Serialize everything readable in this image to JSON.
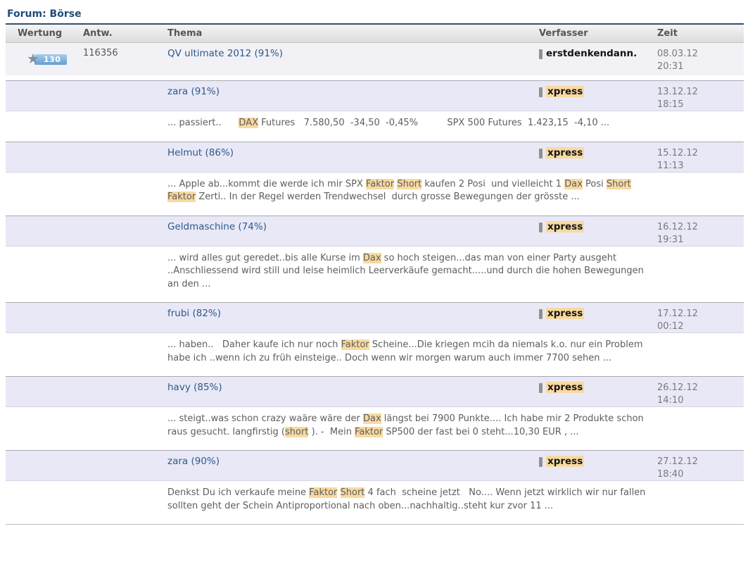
{
  "header": {
    "title": "Forum: Börse"
  },
  "colors": {
    "title_blue": "#1d4d7c",
    "link_blue": "#2b5a8c",
    "highlight_orange": "#f8d9a0",
    "topic_row_lavender": "#e9e8f6",
    "thread_row_gray": "#f2f1f6",
    "badge_blue": "#649ed2"
  },
  "icons": {
    "rating": "star-icon",
    "author_presence": "user-bar-icon"
  },
  "table": {
    "columns": [
      "Wertung",
      "Antw.",
      "Thema",
      "Verfasser",
      "Zeit"
    ],
    "rows": [
      {
        "type": "thread",
        "rating": "130",
        "answers": "116356",
        "topic": "QV ultimate 2012 (91%)",
        "author": {
          "name": "erstdenkendann.",
          "highlight": false
        },
        "date": "08.03.12",
        "time": "20:31",
        "snippet": null
      },
      {
        "type": "post",
        "rating": "",
        "answers": "",
        "topic": "zara (91%)",
        "author": {
          "name": "xpress",
          "highlight": true
        },
        "date": "13.12.12",
        "time": "18:15",
        "snippet": [
          {
            "t": "... passiert..      ",
            "h": false
          },
          {
            "t": "DAX",
            "h": true
          },
          {
            "t": " Futures   7.580,50  -34,50  -0,45%          SPX 500 Futures  1.423,15  -4,10 ...",
            "h": false
          }
        ]
      },
      {
        "type": "post",
        "rating": "",
        "answers": "",
        "topic": "Helmut (86%)",
        "author": {
          "name": "xpress",
          "highlight": true
        },
        "date": "15.12.12",
        "time": "11:13",
        "snippet": [
          {
            "t": "... Apple ab...kommt die werde ich mir SPX ",
            "h": false
          },
          {
            "t": "Faktor",
            "h": true
          },
          {
            "t": " ",
            "h": false
          },
          {
            "t": "Short",
            "h": true
          },
          {
            "t": " kaufen 2 Posi  und vielleicht 1 ",
            "h": false
          },
          {
            "t": "Dax",
            "h": true
          },
          {
            "t": " Posi ",
            "h": false
          },
          {
            "t": "Short",
            "h": true
          },
          {
            "t": " ",
            "h": false
          },
          {
            "t": "Faktor",
            "h": true
          },
          {
            "t": " Zerti.. In der Regel werden Trendwechsel  durch grosse Bewegungen der grösste ...",
            "h": false
          }
        ]
      },
      {
        "type": "post",
        "rating": "",
        "answers": "",
        "topic": "Geldmaschine (74%)",
        "author": {
          "name": "xpress",
          "highlight": true
        },
        "date": "16.12.12",
        "time": "19:31",
        "snippet": [
          {
            "t": "... wird alles gut geredet..bis alle Kurse im ",
            "h": false
          },
          {
            "t": "Dax",
            "h": true
          },
          {
            "t": " so hoch steigen...das man von einer Party ausgeht ..Anschliessend wird still und leise heimlich Leerverkäufe gemacht.....und durch die hohen Bewegungen an den ...",
            "h": false
          }
        ]
      },
      {
        "type": "post",
        "rating": "",
        "answers": "",
        "topic": "frubi (82%)",
        "author": {
          "name": "xpress",
          "highlight": true
        },
        "date": "17.12.12",
        "time": "00:12",
        "snippet": [
          {
            "t": "... haben..   Daher kaufe ich nur noch ",
            "h": false
          },
          {
            "t": "Faktor",
            "h": true
          },
          {
            "t": " Scheine...Die kriegen mcih da niemals k.o. nur ein Problem habe ich ..wenn ich zu früh einsteige.. Doch wenn wir morgen warum auch immer 7700 sehen ...",
            "h": false
          }
        ]
      },
      {
        "type": "post",
        "rating": "",
        "answers": "",
        "topic": "havy (85%)",
        "author": {
          "name": "xpress",
          "highlight": true
        },
        "date": "26.12.12",
        "time": "14:10",
        "snippet": [
          {
            "t": "... steigt..was schon crazy waäre wäre der ",
            "h": false
          },
          {
            "t": "Dax",
            "h": true
          },
          {
            "t": " längst bei 7900 Punkte.... Ich habe mir 2 Produkte schon raus gesucht. langfirstig (",
            "h": false
          },
          {
            "t": "short",
            "h": true
          },
          {
            "t": " ). -  Mein ",
            "h": false
          },
          {
            "t": "Faktor",
            "h": true
          },
          {
            "t": " SP500 der fast bei 0 steht...10,30 EUR , ...",
            "h": false
          }
        ]
      },
      {
        "type": "post",
        "rating": "",
        "answers": "",
        "topic": "zara (90%)",
        "author": {
          "name": "xpress",
          "highlight": true
        },
        "date": "27.12.12",
        "time": "18:40",
        "snippet": [
          {
            "t": "Denkst Du ich verkaufe meine ",
            "h": false
          },
          {
            "t": "Faktor",
            "h": true
          },
          {
            "t": " ",
            "h": false
          },
          {
            "t": "Short",
            "h": true
          },
          {
            "t": " 4 fach  scheine jetzt   No.... Wenn jetzt wirklich wir nur fallen sollten geht der Schein Antiproportional nach oben...nachhaltig..steht kur zvor 11 ...",
            "h": false
          }
        ]
      }
    ]
  }
}
